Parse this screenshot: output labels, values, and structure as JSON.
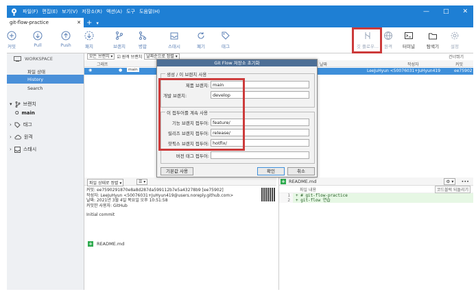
{
  "titlebar": {
    "menus": [
      "파일(F)",
      "편집(E)",
      "보기(V)",
      "저장소(R)",
      "액션(A)",
      "도구",
      "도움말(H)"
    ],
    "minimize": "—",
    "maximize": "□",
    "close": "✕"
  },
  "tabs": [
    {
      "label": "git-flow-practice",
      "close": "✕"
    }
  ],
  "tab_add": "+",
  "tab_menu": "▾",
  "toolbar": {
    "commit": "커밋",
    "pull": "Pull",
    "push": "Push",
    "fetch": "패치",
    "branch": "브랜치",
    "merge": "병합",
    "stash": "스태시",
    "discard": "폐기",
    "tag": "태그",
    "gitflow": "깃 플로우...",
    "remote": "원격",
    "terminal": "터미널",
    "explorer": "탐색기",
    "settings": "설정"
  },
  "sidebar": {
    "workspace": "WORKSPACE",
    "items": [
      "파일 상태",
      "History",
      "Search"
    ],
    "sections": [
      {
        "label": "브랜치",
        "expanded": true
      },
      {
        "label": "태그"
      },
      {
        "label": "원격"
      },
      {
        "label": "스태시"
      }
    ],
    "current_branch": "main",
    "current_marker": "O"
  },
  "main": {
    "filter": {
      "branches": "모든 브랜치",
      "show_remote": "원격 브랜치",
      "sort": "날짜순으로 정렬"
    },
    "graph_header": {
      "graph": "그래프",
      "date": "날짜",
      "author": "작성자",
      "commit": "커밋",
      "col_right": "건너뛰기"
    },
    "commit_row": {
      "branch": "main",
      "author": "LeeJuHyun <50076031+JuHyun419",
      "hash": "ee75902"
    },
    "status_filter": "파일 상태로 정렬",
    "list_icon": "☰",
    "commit_info": {
      "line1": "커밋: ee7590291870e8a8d287da599112b7e5a43278b9 [ee75902]",
      "line2": "작성자: LeeJuHyun <50076031+JuHyun419@users.noreply.github.com>",
      "line3": "날짜: 2021년 3월 4일 목요일 오후 10:51:58",
      "line4": "커밋한 사용자: GitHub",
      "message": "Initial commit"
    },
    "file_chip": "README.md",
    "right": {
      "file": "README.md",
      "sub_header": "파일 내용",
      "rev_button": "코드블럭 되돌리기",
      "more": "•••",
      "diff": [
        {
          "no": "1",
          "text": "+ # git-flow-practice"
        },
        {
          "no": "2",
          "text": "+ git-flow 연습"
        }
      ]
    }
  },
  "dialog": {
    "title": "Git Flow 저장소 초기화",
    "group1": "생성 / 이 브랜치 사용",
    "prod_label": "제품 브랜치:",
    "prod_value": "main",
    "dev_label": "개발 브랜치:",
    "dev_value": "develop",
    "group2": "이 접두어를 계속 사용",
    "feature_label": "기능 브랜치 접두어:",
    "feature_value": "feature/",
    "release_label": "릴리즈 브랜치 접두어:",
    "release_value": "release/",
    "hotfix_label": "핫픽스 브랜치 접두어:",
    "hotfix_value": "hotfix/",
    "tag_label": "버전 태그 접두어:",
    "tag_value": "",
    "defaults_button": "기본값 사용",
    "ok_button": "확인",
    "cancel_button": "취소"
  },
  "colors": {
    "accent": "#1e7fd4",
    "selection": "#3e8fda",
    "highlight": "#cc3a3a"
  }
}
